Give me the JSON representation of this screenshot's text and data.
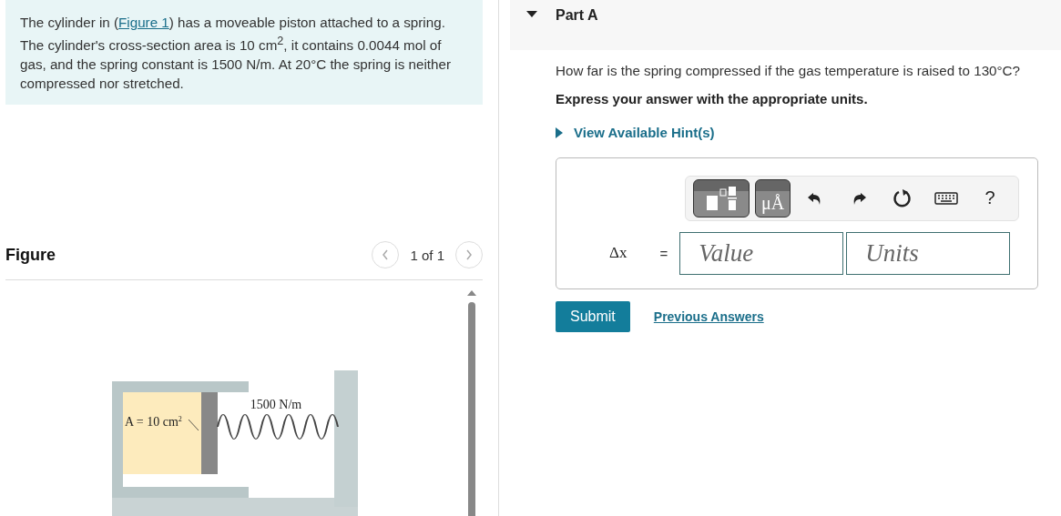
{
  "problem": {
    "text_before": "The cylinder in (",
    "link": "Figure 1",
    "text_after": ") has a moveable piston attached to a spring. The cylinder's cross-section area is 10 cm$^{2}$, it contains 0.0044 mol of gas, and the spring constant is 1500 N/m. At 20°C the spring is neither compressed nor stretched."
  },
  "figure": {
    "title": "Figure",
    "pager": "1 of 1",
    "spring_label": "1500 N/m",
    "area_label": "A = 10 cm$^{2}$"
  },
  "part": {
    "title": "Part A",
    "expanded": true,
    "question": "How far is the spring compressed if the gas temperature is raised to 130°C?",
    "instruction": "Express your answer with the appropriate units.",
    "hint": {
      "label": "View Available Hint(s)",
      "expanded": false
    },
    "toolbar": {
      "units_button": "μÅ",
      "help_button": "?"
    },
    "answer": {
      "variable": "Δx",
      "equals": "=",
      "value_placeholder": "Value",
      "units_placeholder": "Units"
    },
    "submit": "Submit",
    "previous_answers": "Previous Answers"
  }
}
